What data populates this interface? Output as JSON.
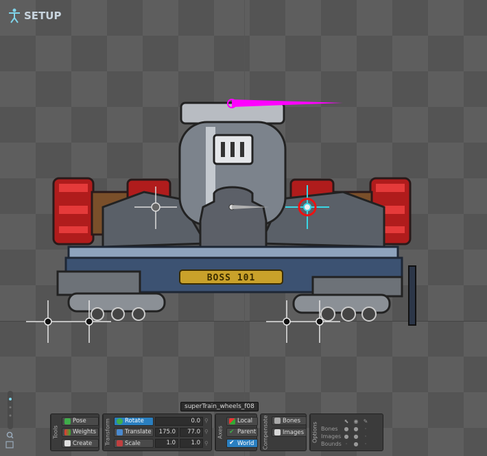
{
  "mode": {
    "label": "SETUP",
    "icon": "skeleton-setup-icon"
  },
  "attachment_tooltip": "superTrain_wheels_f08",
  "boss_plate": "BOSS 101",
  "tools": {
    "title": "Tools",
    "pose": "Pose",
    "weights": "Weights",
    "create": "Create"
  },
  "transform": {
    "title": "Transform",
    "rotate": {
      "label": "Rotate",
      "value": "0.0"
    },
    "translate": {
      "label": "Translate",
      "x": "175.0",
      "y": "77.0"
    },
    "scale": {
      "label": "Scale",
      "x": "1.0",
      "y": "1.0"
    }
  },
  "axes": {
    "title": "Axes",
    "local": "Local",
    "parent": "Parent",
    "world": "World"
  },
  "compensate": {
    "title": "Compensate",
    "bones": "Bones",
    "images": "Images"
  },
  "options": {
    "title": "Options",
    "rows": [
      "Bones",
      "Images",
      "Bounds"
    ],
    "columns": [
      "select-icon",
      "visibility-icon",
      "name-tag-icon"
    ]
  },
  "colors": {
    "accent": "#2a7fc0",
    "selected_bone": "#ff00ff",
    "bone_cyan": "#39d7e6"
  }
}
